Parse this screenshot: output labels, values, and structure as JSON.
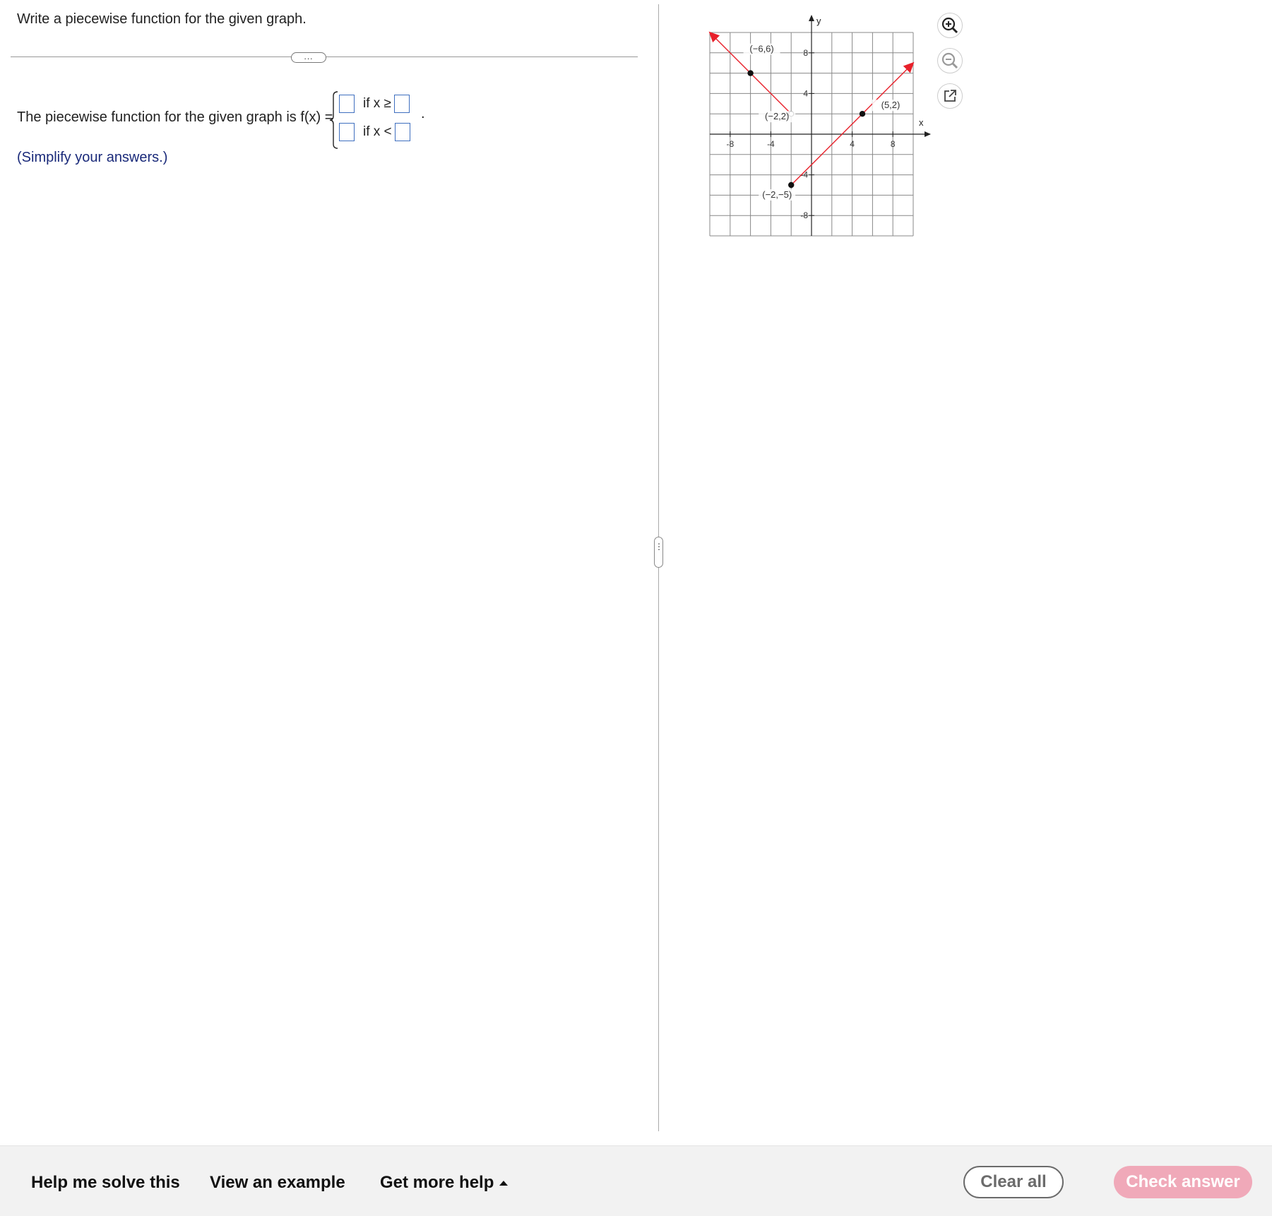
{
  "question": {
    "title": "Write a piecewise function for the given graph.",
    "more_label": "...",
    "answer_prefix": "The piecewise function for the given graph is f(x) =",
    "piece1_condition": "if x ≥",
    "piece2_condition": "if x <",
    "trailing_period": ".",
    "simplify_note": "(Simplify your answers.)"
  },
  "divider": {
    "handle_label": "⋮"
  },
  "graph": {
    "axis_x_label": "x",
    "axis_y_label": "y",
    "x_ticks": [
      "-8",
      "-4",
      "4",
      "8"
    ],
    "y_ticks": [
      "8",
      "4",
      "-4",
      "-8"
    ],
    "point_labels": [
      "(−6,6)",
      "(−2,2)",
      "(5,2)",
      "(−2,−5)"
    ],
    "line_color": "#e8202a"
  },
  "chart_data": {
    "type": "line",
    "xlim": [
      -10,
      10
    ],
    "ylim": [
      -10,
      10
    ],
    "grid": true,
    "series": [
      {
        "x": [
          -10,
          -6,
          -2
        ],
        "y": [
          10,
          6,
          2
        ],
        "endpoint_open": true
      },
      {
        "x": [
          -2,
          5,
          10
        ],
        "y": [
          -5,
          2,
          7
        ],
        "endpoint_open": false
      }
    ],
    "points": [
      {
        "label": "(−6,6)",
        "x": -6,
        "y": 6,
        "filled": true
      },
      {
        "label": "(−2,2)",
        "x": -2,
        "y": 2,
        "filled": false
      },
      {
        "label": "(5,2)",
        "x": 5,
        "y": 2,
        "filled": true
      },
      {
        "label": "(−2,−5)",
        "x": -2,
        "y": -5,
        "filled": true
      }
    ]
  },
  "tools": {
    "zoom_in_icon": "zoom-in-icon",
    "zoom_out_icon": "zoom-out-icon",
    "popout_icon": "external-link-icon"
  },
  "footer": {
    "help_label": "Help me solve this",
    "example_label": "View an example",
    "more_help_label": "Get more help",
    "clear_label": "Clear all",
    "check_label": "Check answer",
    "check_color": "#f0a9b9"
  }
}
